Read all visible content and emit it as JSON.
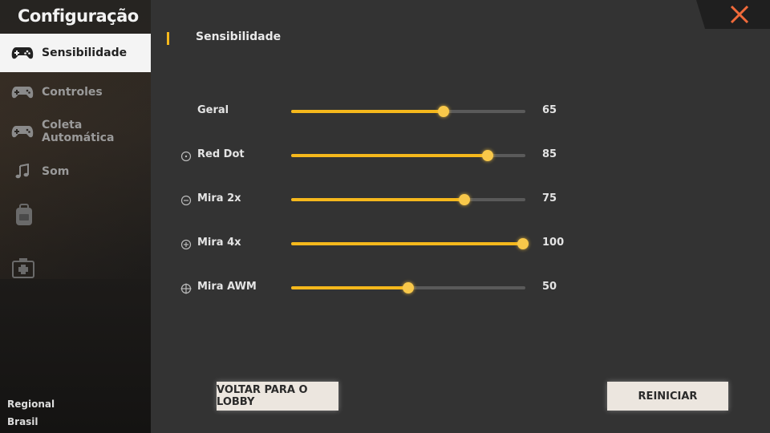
{
  "sidebar": {
    "title": "Configuração",
    "items": [
      {
        "label": "Sensibilidade",
        "icon": "gamepad-icon",
        "active": true
      },
      {
        "label": "Controles",
        "icon": "gamepad-icon",
        "active": false
      },
      {
        "label": "Coleta Automática",
        "icon": "gamepad-icon",
        "active": false
      },
      {
        "label": "Som",
        "icon": "music-note-icon",
        "active": false
      }
    ],
    "extra_icons": [
      "backpack-icon",
      "medkit-icon"
    ],
    "region_label": "Regional",
    "region_value": "Brasil"
  },
  "main": {
    "section_title": "Sensibilidade",
    "sliders": [
      {
        "label": "Geral",
        "value": "65",
        "icon": null
      },
      {
        "label": "Red Dot",
        "value": "85",
        "icon": "red-dot-scope-icon"
      },
      {
        "label": "Mira 2x",
        "value": "75",
        "icon": "scope-2x-icon"
      },
      {
        "label": "Mira 4x",
        "value": "100",
        "icon": "scope-4x-icon"
      },
      {
        "label": "Mira AWM",
        "value": "50",
        "icon": "crosshair-icon"
      }
    ],
    "back_button": "VOLTAR PARA O LOBBY",
    "reset_button": "REINICIAR"
  },
  "colors": {
    "accent": "#f5b81c",
    "panel": "#333333",
    "close": "#f06a3a"
  }
}
